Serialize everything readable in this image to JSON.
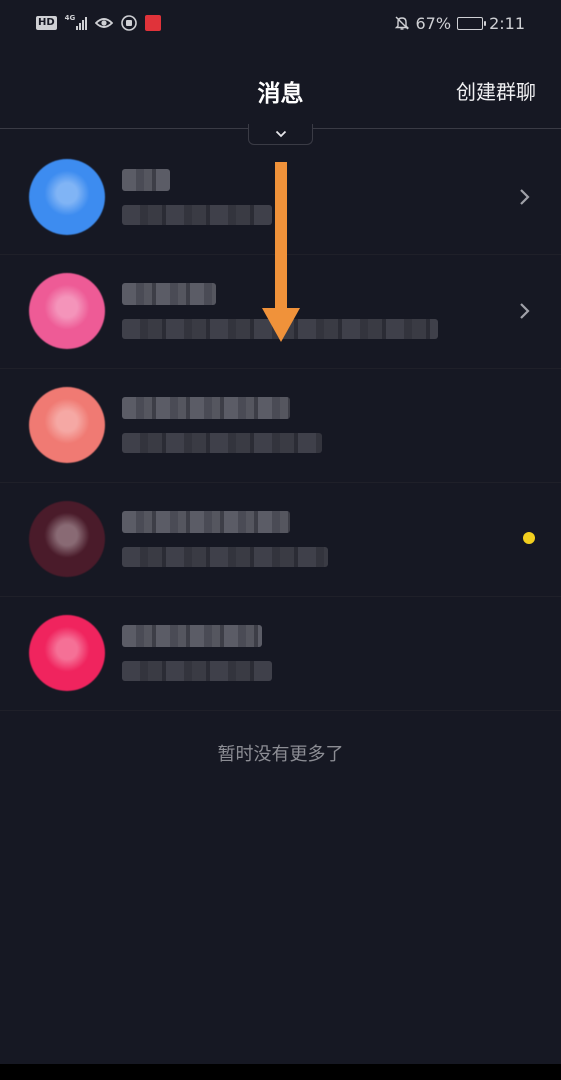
{
  "status_bar": {
    "hd": "HD",
    "network": "4G",
    "battery_percent": "67%",
    "battery_level": 0.67,
    "time": "2:11",
    "icons": [
      "signal-icon",
      "eye-icon",
      "app-icon",
      "red-app-icon",
      "mute-bell-icon",
      "battery-icon"
    ]
  },
  "header": {
    "title": "消息",
    "action": "创建群聊"
  },
  "messages": [
    {
      "avatar_color": "#3d8cf0",
      "has_chevron": true,
      "unread": false
    },
    {
      "avatar_color": "#ee5b96",
      "has_chevron": true,
      "unread": false
    },
    {
      "avatar_color": "#f07a73",
      "has_chevron": false,
      "unread": false
    },
    {
      "avatar_color": "#4a1b2a",
      "has_chevron": false,
      "unread": true
    },
    {
      "avatar_color": "#f0245e",
      "has_chevron": false,
      "unread": false
    }
  ],
  "footer_note": "暂时没有更多了",
  "colors": {
    "background": "#161823",
    "unread_dot": "#f2cf1f",
    "annotation_arrow": "#f0923a"
  }
}
